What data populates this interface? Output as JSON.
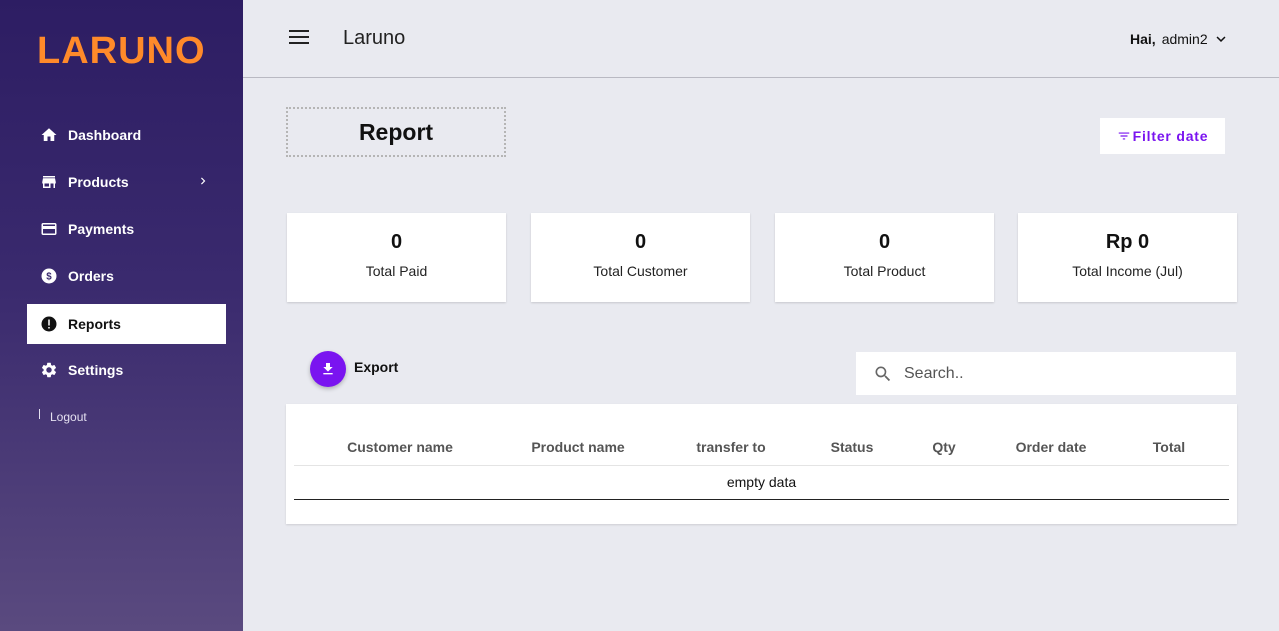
{
  "brand": {
    "logo": "LARUNO",
    "logo_color": "#ff8a2a"
  },
  "sidebar": {
    "items": [
      {
        "label": "Dashboard",
        "icon": "home-icon"
      },
      {
        "label": "Products",
        "icon": "store-icon"
      },
      {
        "label": "Payments",
        "icon": "credit-card-icon"
      },
      {
        "label": "Orders",
        "icon": "dollar-circle-icon"
      },
      {
        "label": "Reports",
        "icon": "exclamation-circle-icon",
        "active": true
      },
      {
        "label": "Settings",
        "icon": "gear-icon"
      }
    ],
    "logout": "Logout"
  },
  "header": {
    "title": "Laruno",
    "greeting": "Hai,",
    "username": "admin2"
  },
  "page": {
    "title": "Report",
    "filter_label": "Filter date",
    "accent": "#7a14f0"
  },
  "stats": [
    {
      "value": "0",
      "label": "Total Paid"
    },
    {
      "value": "0",
      "label": "Total Customer"
    },
    {
      "value": "0",
      "label": "Total Product"
    },
    {
      "value": "Rp 0",
      "label": "Total Income (Jul)"
    }
  ],
  "toolbar": {
    "export_label": "Export",
    "search_placeholder": "Search.."
  },
  "table": {
    "columns": [
      "Customer name",
      "Product name",
      "transfer to",
      "Status",
      "Qty",
      "Order date",
      "Total"
    ],
    "empty_text": "empty data"
  }
}
